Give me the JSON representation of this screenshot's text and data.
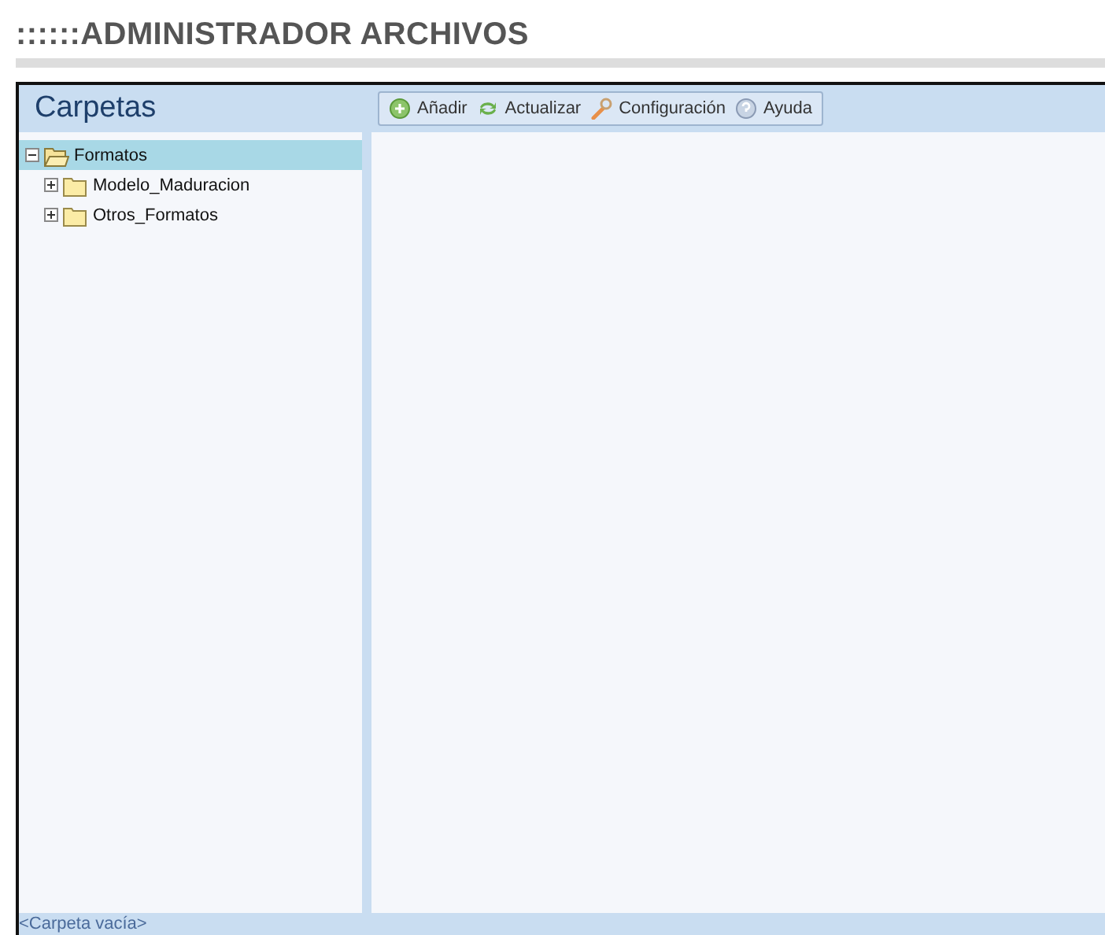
{
  "page_title": "::::::ADMINISTRADOR ARCHIVOS",
  "sidebar": {
    "title": "Carpetas",
    "tree": [
      {
        "label": "Formatos",
        "expanded": true,
        "selected": true,
        "children": [
          {
            "label": "Modelo_Maduracion",
            "expanded": false,
            "selected": false
          },
          {
            "label": "Otros_Formatos",
            "expanded": false,
            "selected": false
          }
        ]
      }
    ]
  },
  "toolbar": [
    {
      "kind": "add",
      "label": "Añadir"
    },
    {
      "kind": "refresh",
      "label": "Actualizar"
    },
    {
      "kind": "settings",
      "label": "Configuración"
    },
    {
      "kind": "help",
      "label": "Ayuda"
    }
  ],
  "status_bar": "<Carpeta vacía>"
}
